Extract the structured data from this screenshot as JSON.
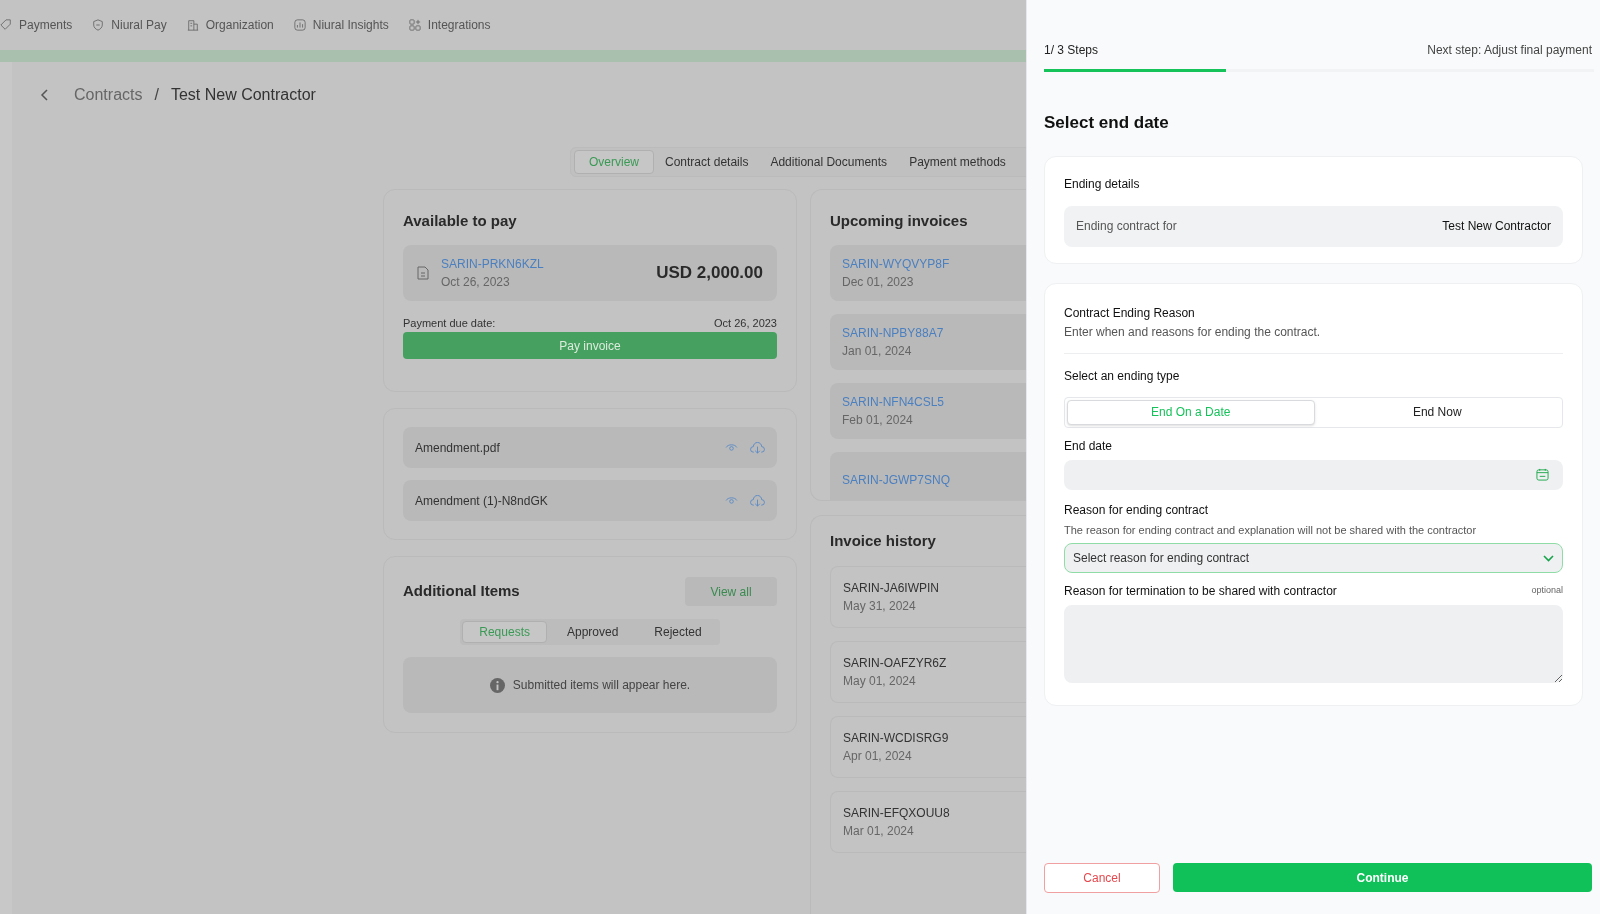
{
  "nav": [
    {
      "label": "Payments"
    },
    {
      "label": "Niural Pay"
    },
    {
      "label": "Organization"
    },
    {
      "label": "Niural Insights"
    },
    {
      "label": "Integrations"
    }
  ],
  "breadcrumb": {
    "parent": "Contracts",
    "separator": "/",
    "current": "Test New Contractor"
  },
  "tabs": [
    {
      "label": "Overview",
      "selected": true
    },
    {
      "label": "Contract details",
      "selected": false
    },
    {
      "label": "Additional Documents",
      "selected": false
    },
    {
      "label": "Payment methods",
      "selected": false
    }
  ],
  "available_to_pay": {
    "title": "Available to pay",
    "invoice_id": "SARIN-PRKN6KZL",
    "invoice_date": "Oct 26, 2023",
    "amount": "USD 2,000.00",
    "due_label": "Payment due date:",
    "due_date": "Oct 26, 2023",
    "button": "Pay invoice"
  },
  "documents": [
    {
      "name": "Amendment.pdf"
    },
    {
      "name": "Amendment (1)-N8ndGK"
    }
  ],
  "additional_items": {
    "title": "Additional Items",
    "view_all": "View all",
    "tabs": [
      {
        "label": "Requests",
        "selected": true
      },
      {
        "label": "Approved",
        "selected": false
      },
      {
        "label": "Rejected",
        "selected": false
      }
    ],
    "empty_message": "Submitted items will appear here."
  },
  "upcoming_invoices": {
    "title": "Upcoming invoices",
    "items": [
      {
        "id": "SARIN-WYQVYP8F",
        "date": "Dec 01, 2023"
      },
      {
        "id": "SARIN-NPBY88A7",
        "date": "Jan 01, 2024"
      },
      {
        "id": "SARIN-NFN4CSL5",
        "date": "Feb 01, 2024"
      },
      {
        "id": "SARIN-JGWP7SNQ"
      }
    ]
  },
  "invoice_history": {
    "title": "Invoice history",
    "items": [
      {
        "id": "SARIN-JA6IWPIN",
        "date": "May 31, 2024"
      },
      {
        "id": "SARIN-OAFZYR6Z",
        "date": "May 01, 2024"
      },
      {
        "id": "SARIN-WCDISRG9",
        "date": "Apr 01, 2024"
      },
      {
        "id": "SARIN-EFQXOUU8",
        "date": "Mar 01, 2024"
      }
    ]
  },
  "panel": {
    "step_label": "1/ 3 Steps",
    "level": 0.33,
    "next_step": "Next step: Adjust final payment",
    "title": "Select end date",
    "ending_details": {
      "title": "Ending details",
      "label": "Ending contract for",
      "value": "Test New Contractor"
    },
    "reason": {
      "title": "Contract Ending Reason",
      "subtitle": "Enter when and reasons for ending the contract.",
      "ending_type_label": "Select an ending type",
      "ending_types": [
        {
          "label": "End On a Date",
          "selected": true
        },
        {
          "label": "End Now",
          "selected": false
        }
      ],
      "end_date_label": "End date",
      "reason_label": "Reason for ending contract",
      "reason_hint": "The reason for ending contract and explanation will not be shared with the contractor",
      "reason_placeholder": "Select reason for ending contract",
      "termination_label": "Reason for termination to be shared with contractor",
      "optional": "optional"
    },
    "cancel": "Cancel",
    "continue": "Continue"
  }
}
